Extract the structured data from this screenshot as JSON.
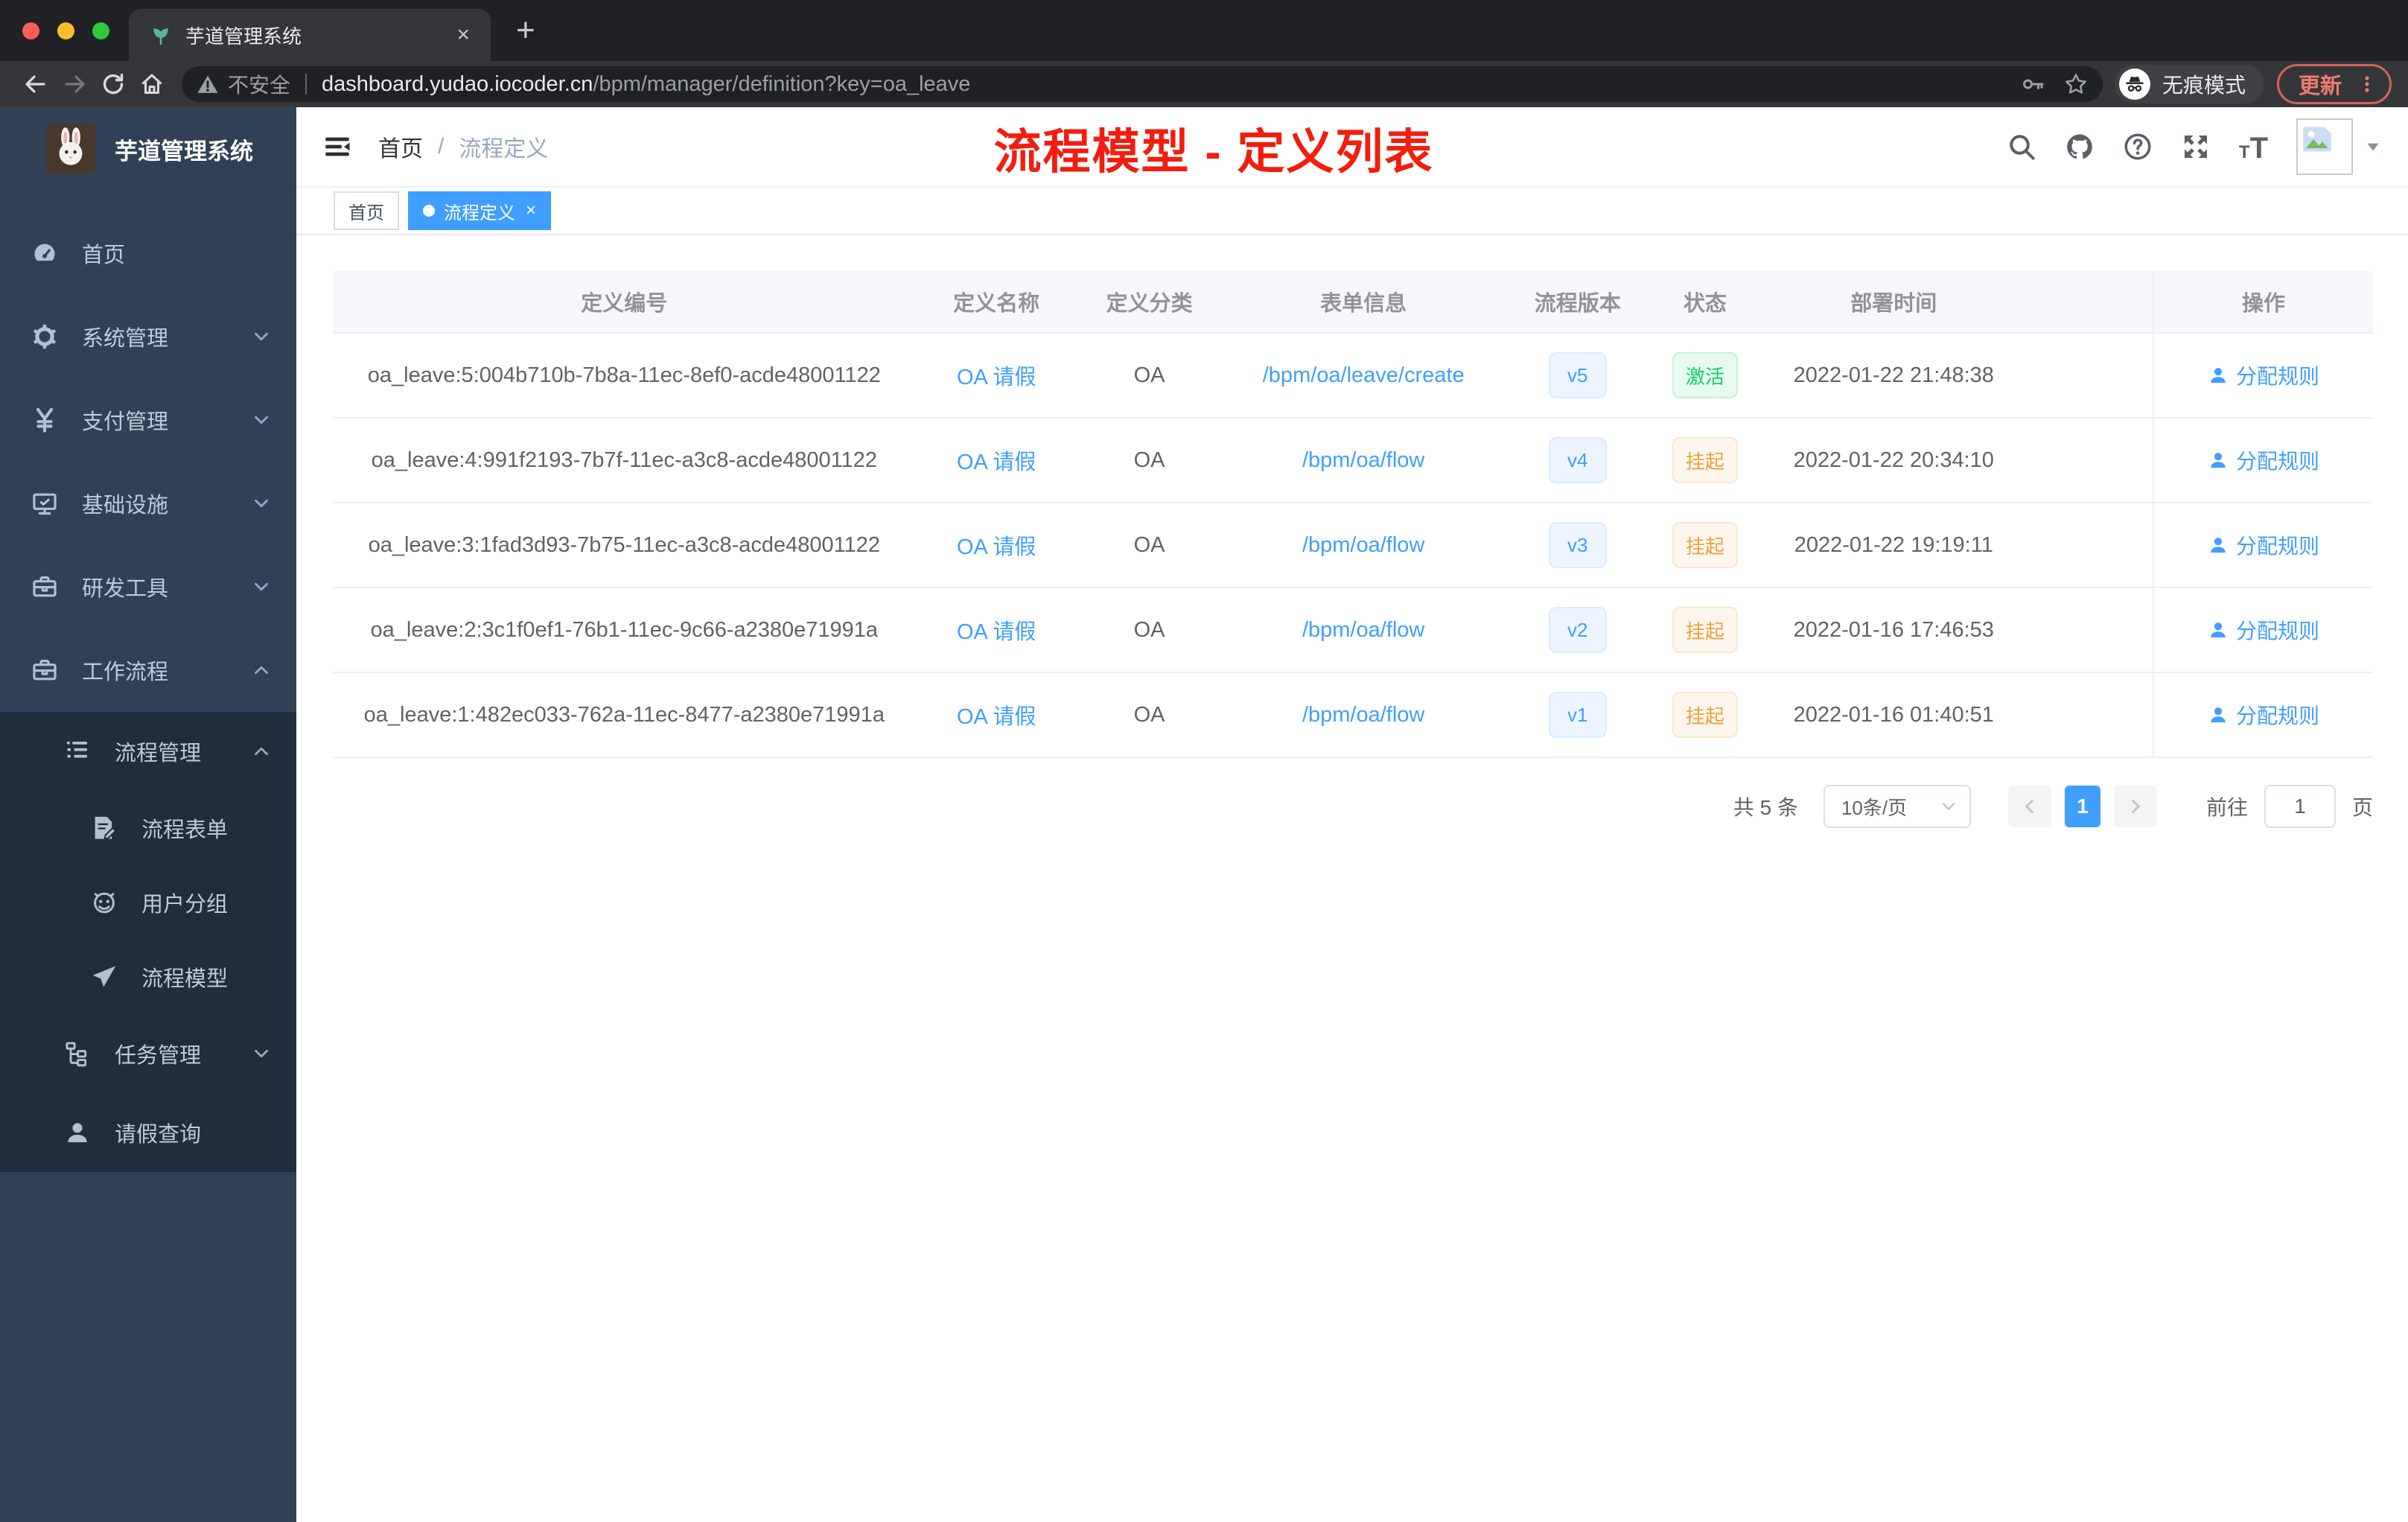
{
  "colors": {
    "accent": "#409eff",
    "annotation_red": "#f21d0d",
    "success": "#13ce66",
    "warning": "#e6a23c",
    "sidebar_bg": "#304156",
    "submenu_bg": "#1f2d3d"
  },
  "browser": {
    "tab": {
      "title": "芋道管理系统",
      "close": "×",
      "new_tab": "+"
    },
    "url": {
      "security": "不安全",
      "domain": "dashboard.yudao.iocoder.cn",
      "path": "/bpm/manager/definition?key=oa_leave"
    },
    "incognito_label": "无痕模式",
    "update_label": "更新"
  },
  "sidebar": {
    "logo_title": "芋道管理系统",
    "menu": [
      {
        "label": "首页",
        "icon": "dashboard-icon",
        "level": 0,
        "dark": false,
        "chevron": ""
      },
      {
        "label": "系统管理",
        "icon": "gear-icon",
        "level": 0,
        "dark": false,
        "chevron": "down"
      },
      {
        "label": "支付管理",
        "icon": "yen-icon",
        "level": 0,
        "dark": false,
        "chevron": "down"
      },
      {
        "label": "基础设施",
        "icon": "monitor-icon",
        "level": 0,
        "dark": false,
        "chevron": "down"
      },
      {
        "label": "研发工具",
        "icon": "briefcase-icon",
        "level": 0,
        "dark": false,
        "chevron": "down"
      },
      {
        "label": "工作流程",
        "icon": "briefcase-icon",
        "level": 0,
        "dark": false,
        "chevron": "up"
      },
      {
        "label": "流程管理",
        "icon": "list-tree-icon",
        "level": 1,
        "dark": true,
        "chevron": "up"
      },
      {
        "label": "流程表单",
        "icon": "form-edit-icon",
        "level": 2,
        "dark": true,
        "chevron": ""
      },
      {
        "label": "用户分组",
        "icon": "robot-icon",
        "level": 2,
        "dark": true,
        "chevron": ""
      },
      {
        "label": "流程模型",
        "icon": "paper-plane-icon",
        "level": 2,
        "dark": true,
        "chevron": ""
      },
      {
        "label": "任务管理",
        "icon": "org-tree-icon",
        "level": 1,
        "dark": true,
        "chevron": "down"
      },
      {
        "label": "请假查询",
        "icon": "user-icon",
        "level": 1,
        "dark": true,
        "chevron": ""
      }
    ]
  },
  "header": {
    "breadcrumb": {
      "first": "首页",
      "separator": "/",
      "last": "流程定义"
    },
    "annotation": "流程模型 - 定义列表"
  },
  "tags": [
    {
      "label": "首页",
      "active": false,
      "closable": false
    },
    {
      "label": "流程定义",
      "active": true,
      "closable": true,
      "close": "×"
    }
  ],
  "table": {
    "columns": [
      "定义编号",
      "定义名称",
      "定义分类",
      "表单信息",
      "流程版本",
      "状态",
      "部署时间",
      "",
      "操作"
    ],
    "rows": [
      {
        "id": "oa_leave:5:004b710b-7b8a-11ec-8ef0-acde48001122",
        "name": "OA 请假",
        "category": "OA",
        "form": "/bpm/oa/leave/create",
        "version": "v5",
        "status": "激活",
        "status_type": "success",
        "deploy_time": "2022-01-22 21:48:38",
        "action": "分配规则"
      },
      {
        "id": "oa_leave:4:991f2193-7b7f-11ec-a3c8-acde48001122",
        "name": "OA 请假",
        "category": "OA",
        "form": "/bpm/oa/flow",
        "version": "v4",
        "status": "挂起",
        "status_type": "warning",
        "deploy_time": "2022-01-22 20:34:10",
        "action": "分配规则"
      },
      {
        "id": "oa_leave:3:1fad3d93-7b75-11ec-a3c8-acde48001122",
        "name": "OA 请假",
        "category": "OA",
        "form": "/bpm/oa/flow",
        "version": "v3",
        "status": "挂起",
        "status_type": "warning",
        "deploy_time": "2022-01-22 19:19:11",
        "action": "分配规则"
      },
      {
        "id": "oa_leave:2:3c1f0ef1-76b1-11ec-9c66-a2380e71991a",
        "name": "OA 请假",
        "category": "OA",
        "form": "/bpm/oa/flow",
        "version": "v2",
        "status": "挂起",
        "status_type": "warning",
        "deploy_time": "2022-01-16 17:46:53",
        "action": "分配规则"
      },
      {
        "id": "oa_leave:1:482ec033-762a-11ec-8477-a2380e71991a",
        "name": "OA 请假",
        "category": "OA",
        "form": "/bpm/oa/flow",
        "version": "v1",
        "status": "挂起",
        "status_type": "warning",
        "deploy_time": "2022-01-16 01:40:51",
        "action": "分配规则"
      }
    ]
  },
  "pagination": {
    "total_text": "共 5 条",
    "page_size_label": "10条/页",
    "current_page": "1",
    "goto_label": "前往",
    "goto_value": "1",
    "page_unit": "页"
  }
}
